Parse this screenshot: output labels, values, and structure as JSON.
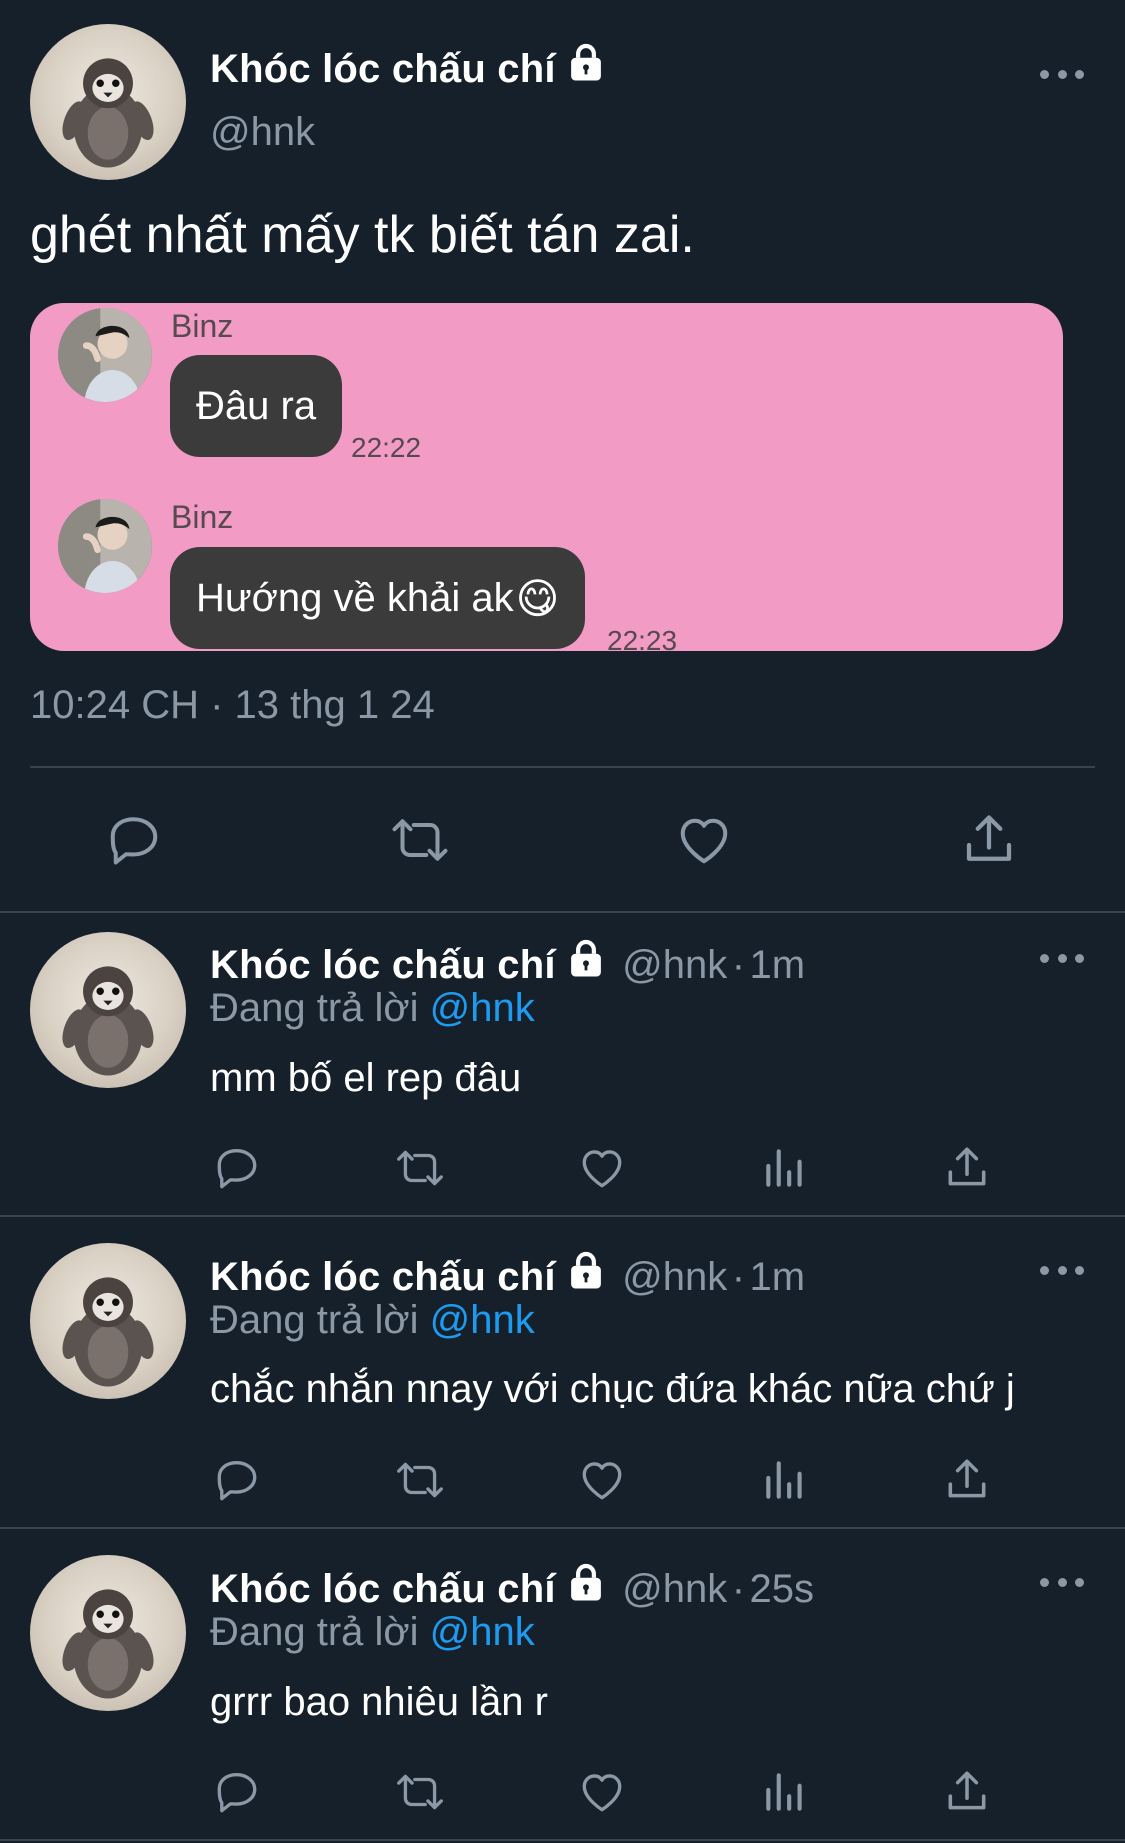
{
  "tweet": {
    "display_name": "Khóc lóc chấu chí",
    "handle": "@hnk",
    "text": "ghét nhất mấy tk biết tán zai.",
    "timestamp": "10:24 CH · 13 thg 1 24",
    "image": {
      "background": "#f29bc4",
      "messages": [
        {
          "sender": "Binz",
          "text": "Đâu ra",
          "time": "22:22"
        },
        {
          "sender": "Binz",
          "text": "Hướng về khải ak",
          "emoji": "😋",
          "time": "22:23"
        }
      ]
    }
  },
  "replies": [
    {
      "display_name": "Khóc lóc chấu chí",
      "handle": "@hnk",
      "age": "1m",
      "replying_label": "Đang trả lời",
      "replying_to": "@hnk",
      "text": "mm bố el rep đâu"
    },
    {
      "display_name": "Khóc lóc chấu chí",
      "handle": "@hnk",
      "age": "1m",
      "replying_label": "Đang trả lời",
      "replying_to": "@hnk",
      "text": "chắc nhắn nnay với chục đứa khác nữa chứ j"
    },
    {
      "display_name": "Khóc lóc chấu chí",
      "handle": "@hnk",
      "age": "25s",
      "replying_label": "Đang trả lời",
      "replying_to": "@hnk",
      "text": "grrr bao nhiêu lần r"
    }
  ],
  "separator": "·",
  "colors": {
    "background": "#15202b",
    "muted": "#8b98a5",
    "link": "#1d9bf0",
    "divider": "#38444d"
  },
  "icons": [
    "reply-icon",
    "retweet-icon",
    "like-icon",
    "views-icon",
    "share-icon",
    "lock-icon",
    "more-icon"
  ]
}
